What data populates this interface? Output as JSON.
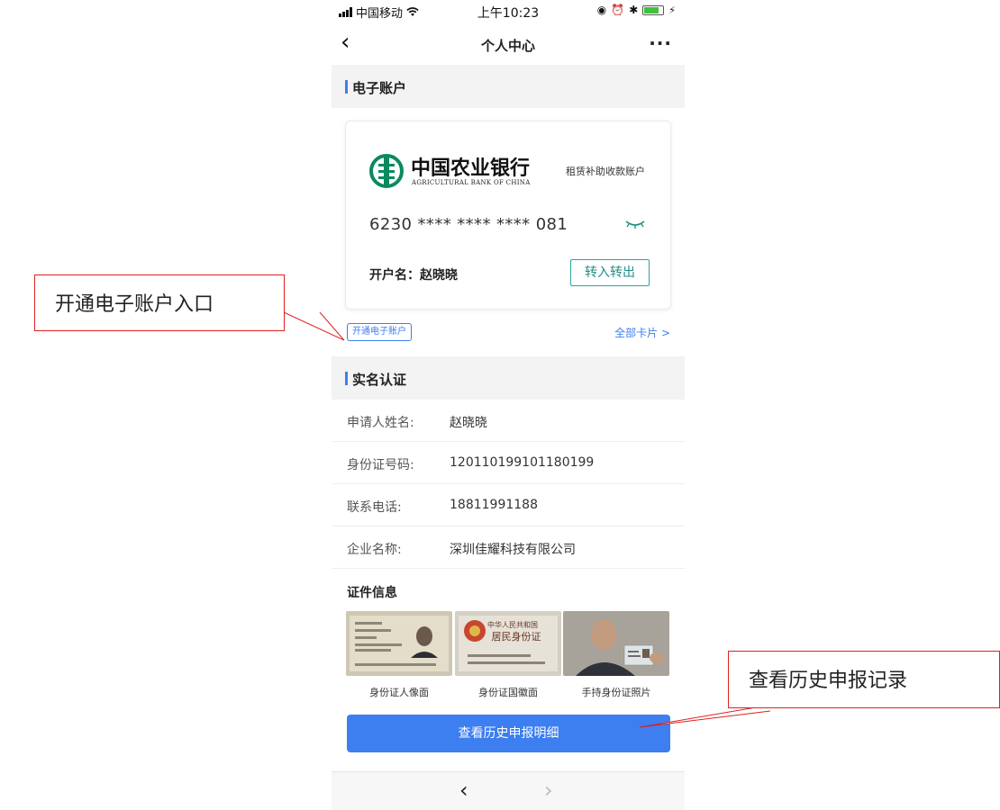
{
  "status_bar": {
    "carrier": "中国移动",
    "time": "上午10:23"
  },
  "nav": {
    "title": "个人中心",
    "more": "···"
  },
  "e_account": {
    "section_title": "电子账户",
    "bank_name": "中国农业银行",
    "bank_name_en": "AGRICULTURAL BANK OF CHINA",
    "account_type": "租赁补助收款账户",
    "card_number": "6230 **** **** **** 081",
    "holder": "开户名：赵晓晓",
    "transfer_label": "转入转出",
    "open_account_label": "开通电子账户",
    "all_cards_label": "全部卡片 >"
  },
  "real_name": {
    "section_title": "实名认证",
    "rows": [
      {
        "label": "申请人姓名:",
        "value": "赵晓晓"
      },
      {
        "label": "身份证号码:",
        "value": "120110199101180199"
      },
      {
        "label": "联系电话:",
        "value": "18811991188"
      },
      {
        "label": "企业名称:",
        "value": "深圳佳耀科技有限公司"
      }
    ]
  },
  "certificates": {
    "title": "证件信息",
    "items": [
      {
        "caption": "身份证人像面"
      },
      {
        "caption": "身份证国徽面"
      },
      {
        "caption": "手持身份证照片"
      }
    ],
    "id_back_text_1": "中华人民共和国",
    "id_back_text_2": "居民身份证"
  },
  "history_button": "查看历史申报明细",
  "bottom_nav": {
    "prev": "‹",
    "next": "›"
  },
  "callouts": {
    "open_account": "开通电子账户入口",
    "history": "查看历史申报记录"
  },
  "colors": {
    "accent": "#3d7ef0",
    "bank_green": "#0a8a5e",
    "callout_red": "#e02020"
  }
}
